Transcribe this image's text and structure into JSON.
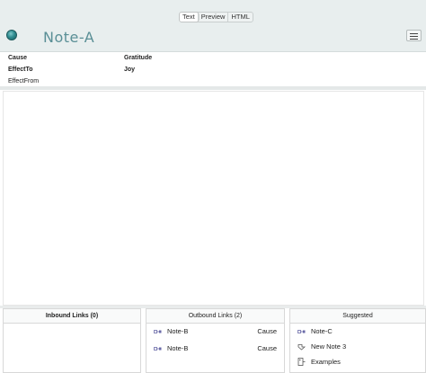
{
  "view_modes": [
    "Text",
    "Preview",
    "HTML"
  ],
  "note": {
    "title": "Note-A"
  },
  "attributes": [
    {
      "key": "Cause",
      "value": "Gratitude"
    },
    {
      "key": "EffectTo",
      "value": "Joy"
    },
    {
      "key": "EffectFrom",
      "value": ""
    }
  ],
  "editor": {
    "text": ""
  },
  "panes": {
    "inbound": {
      "title": "Inbound Links (0)",
      "items": []
    },
    "outbound": {
      "title": "Outbound Links (2)",
      "items": [
        {
          "label": "Note-B",
          "type": "Cause"
        },
        {
          "label": "Note-B",
          "type": "Cause"
        }
      ]
    },
    "suggested": {
      "title": "Suggested",
      "items": [
        {
          "label": "Note-C",
          "icon": "link-icon"
        },
        {
          "label": "New Note 3",
          "icon": "new-note-icon"
        },
        {
          "label": "Examples",
          "icon": "container-icon"
        }
      ]
    }
  }
}
